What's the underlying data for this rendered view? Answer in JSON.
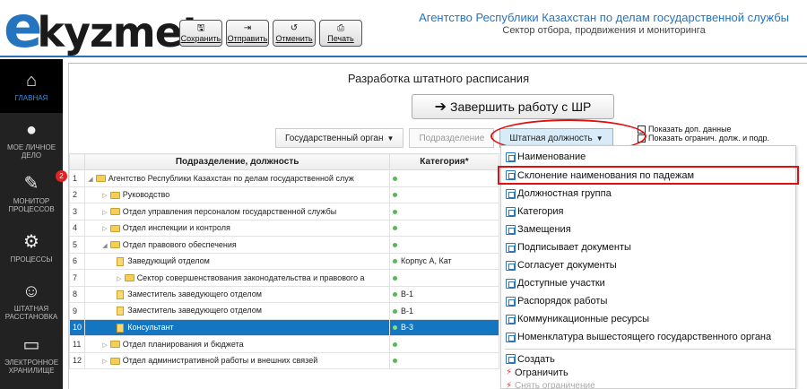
{
  "logo": {
    "e": "e",
    "rest": "kyzmet"
  },
  "toolbar": [
    {
      "label": "Сохранить",
      "icon": "save-icon",
      "glyph": "🖫"
    },
    {
      "label": "Отправить",
      "icon": "send-icon",
      "glyph": "⇥"
    },
    {
      "label": "Отменить",
      "icon": "undo-icon",
      "glyph": "↺"
    },
    {
      "label": "Печать",
      "icon": "print-icon",
      "glyph": "⎙"
    }
  ],
  "agency": {
    "title": "Агентство Республики Казахстан по делам государственной службы",
    "subtitle": "Сектор отбора, продвижения и мониторинга"
  },
  "sidebar": [
    {
      "label": "ГЛАВНАЯ",
      "icon": "home-icon",
      "glyph": "⌂",
      "active": true
    },
    {
      "label": "МОЕ ЛИЧНОЕ ДЕЛО",
      "icon": "user-icon",
      "glyph": "●"
    },
    {
      "label": "МОНИТОР ПРОЦЕССОВ",
      "icon": "edit-icon",
      "glyph": "✎",
      "badge": "2"
    },
    {
      "label": "ПРОЦЕССЫ",
      "icon": "gears-icon",
      "glyph": "⚙"
    },
    {
      "label": "ШТАТНАЯ РАССТАНОВКА",
      "icon": "people-icon",
      "glyph": "☺"
    },
    {
      "label": "ЭЛЕКТРОННОЕ ХРАНИЛИЩЕ",
      "icon": "inbox-icon",
      "glyph": "▭"
    }
  ],
  "main": {
    "title": "Разработка штатного расписания",
    "finish_button": "Завершить работу с ШР",
    "filters": [
      {
        "label": "Государственный орган",
        "state": "normal"
      },
      {
        "label": "Подразделение",
        "state": "disabled"
      },
      {
        "label": "Штатная должность",
        "state": "selected"
      }
    ],
    "checkboxes": [
      "Показать доп. данные",
      "Показать огранич. долж. и подр."
    ]
  },
  "table": {
    "headers": [
      "",
      "Подразделение, должность",
      "Категория*"
    ],
    "rows": [
      {
        "n": "1",
        "indent": 0,
        "toggle": "◢",
        "type": "folder",
        "name": "Агентство Республики Казахстан по делам государственной служ",
        "cat": ""
      },
      {
        "n": "2",
        "indent": 1,
        "toggle": "▷",
        "type": "folder",
        "name": "Руководство",
        "cat": ""
      },
      {
        "n": "3",
        "indent": 1,
        "toggle": "▷",
        "type": "folder",
        "name": "Отдел управления персоналом государственной службы",
        "cat": ""
      },
      {
        "n": "4",
        "indent": 1,
        "toggle": "▷",
        "type": "folder",
        "name": "Отдел инспекции и контроля",
        "cat": ""
      },
      {
        "n": "5",
        "indent": 1,
        "toggle": "◢",
        "type": "folder",
        "name": "Отдел правового обеспечения",
        "cat": ""
      },
      {
        "n": "6",
        "indent": 2,
        "toggle": "",
        "type": "doc",
        "name": "Заведующий отделом",
        "cat": "Корпус А, Кат"
      },
      {
        "n": "7",
        "indent": 2,
        "toggle": "▷",
        "type": "folder",
        "name": "Сектор совершенствования законодательства и правового а",
        "cat": ""
      },
      {
        "n": "8",
        "indent": 2,
        "toggle": "",
        "type": "doc",
        "name": "Заместитель заведующего отделом",
        "cat": "В-1"
      },
      {
        "n": "9",
        "indent": 2,
        "toggle": "",
        "type": "doc",
        "name": "Заместитель заведующего отделом",
        "cat": "В-1"
      },
      {
        "n": "10",
        "indent": 2,
        "toggle": "",
        "type": "doc",
        "name": "Консультант",
        "cat": "В-3",
        "selected": true
      },
      {
        "n": "11",
        "indent": 1,
        "toggle": "▷",
        "type": "folder",
        "name": "Отдел планирования и бюджета",
        "cat": ""
      },
      {
        "n": "12",
        "indent": 1,
        "toggle": "▷",
        "type": "folder",
        "name": "Отдел административной работы и внешних связей",
        "cat": ""
      }
    ]
  },
  "menu": {
    "items": [
      "Наименование",
      "Склонение наименования по падежам",
      "Должностная группа",
      "Категория",
      "Замещения",
      "Подписывает документы",
      "Согласует документы",
      "Доступные участки",
      "Распорядок работы",
      "Коммуникационные ресурсы",
      "Номенклатура вышестоящего государственного органа"
    ],
    "highlighted_index": 1,
    "actions": [
      {
        "label": "Создать",
        "icon": "create-icon",
        "disabled": false
      },
      {
        "label": "Ограничить",
        "icon": "bolt-icon",
        "disabled": false
      },
      {
        "label": "Снять ограничение",
        "icon": "bolt-icon",
        "disabled": true
      }
    ]
  },
  "colors": {
    "brand_blue": "#2474c0",
    "selection": "#1476c0",
    "highlight_red": "#e01010",
    "sidebar_bg": "#222222"
  }
}
